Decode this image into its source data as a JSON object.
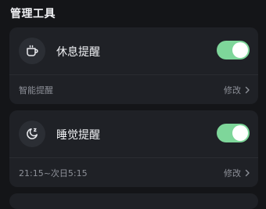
{
  "section": {
    "title": "管理工具"
  },
  "rest_reminder": {
    "title": "休息提醒",
    "enabled": true,
    "detail_label": "智能提醒",
    "action_label": "修改",
    "icon": "coffee-cup-icon"
  },
  "sleep_reminder": {
    "title": "睡觉提醒",
    "enabled": true,
    "detail_label": "21:15~次日5:15",
    "action_label": "修改",
    "icon": "moon-sleep-icon"
  },
  "colors": {
    "toggle_on": "#7ed69a",
    "card_bg": "#1f2126",
    "page_bg": "#141518"
  }
}
